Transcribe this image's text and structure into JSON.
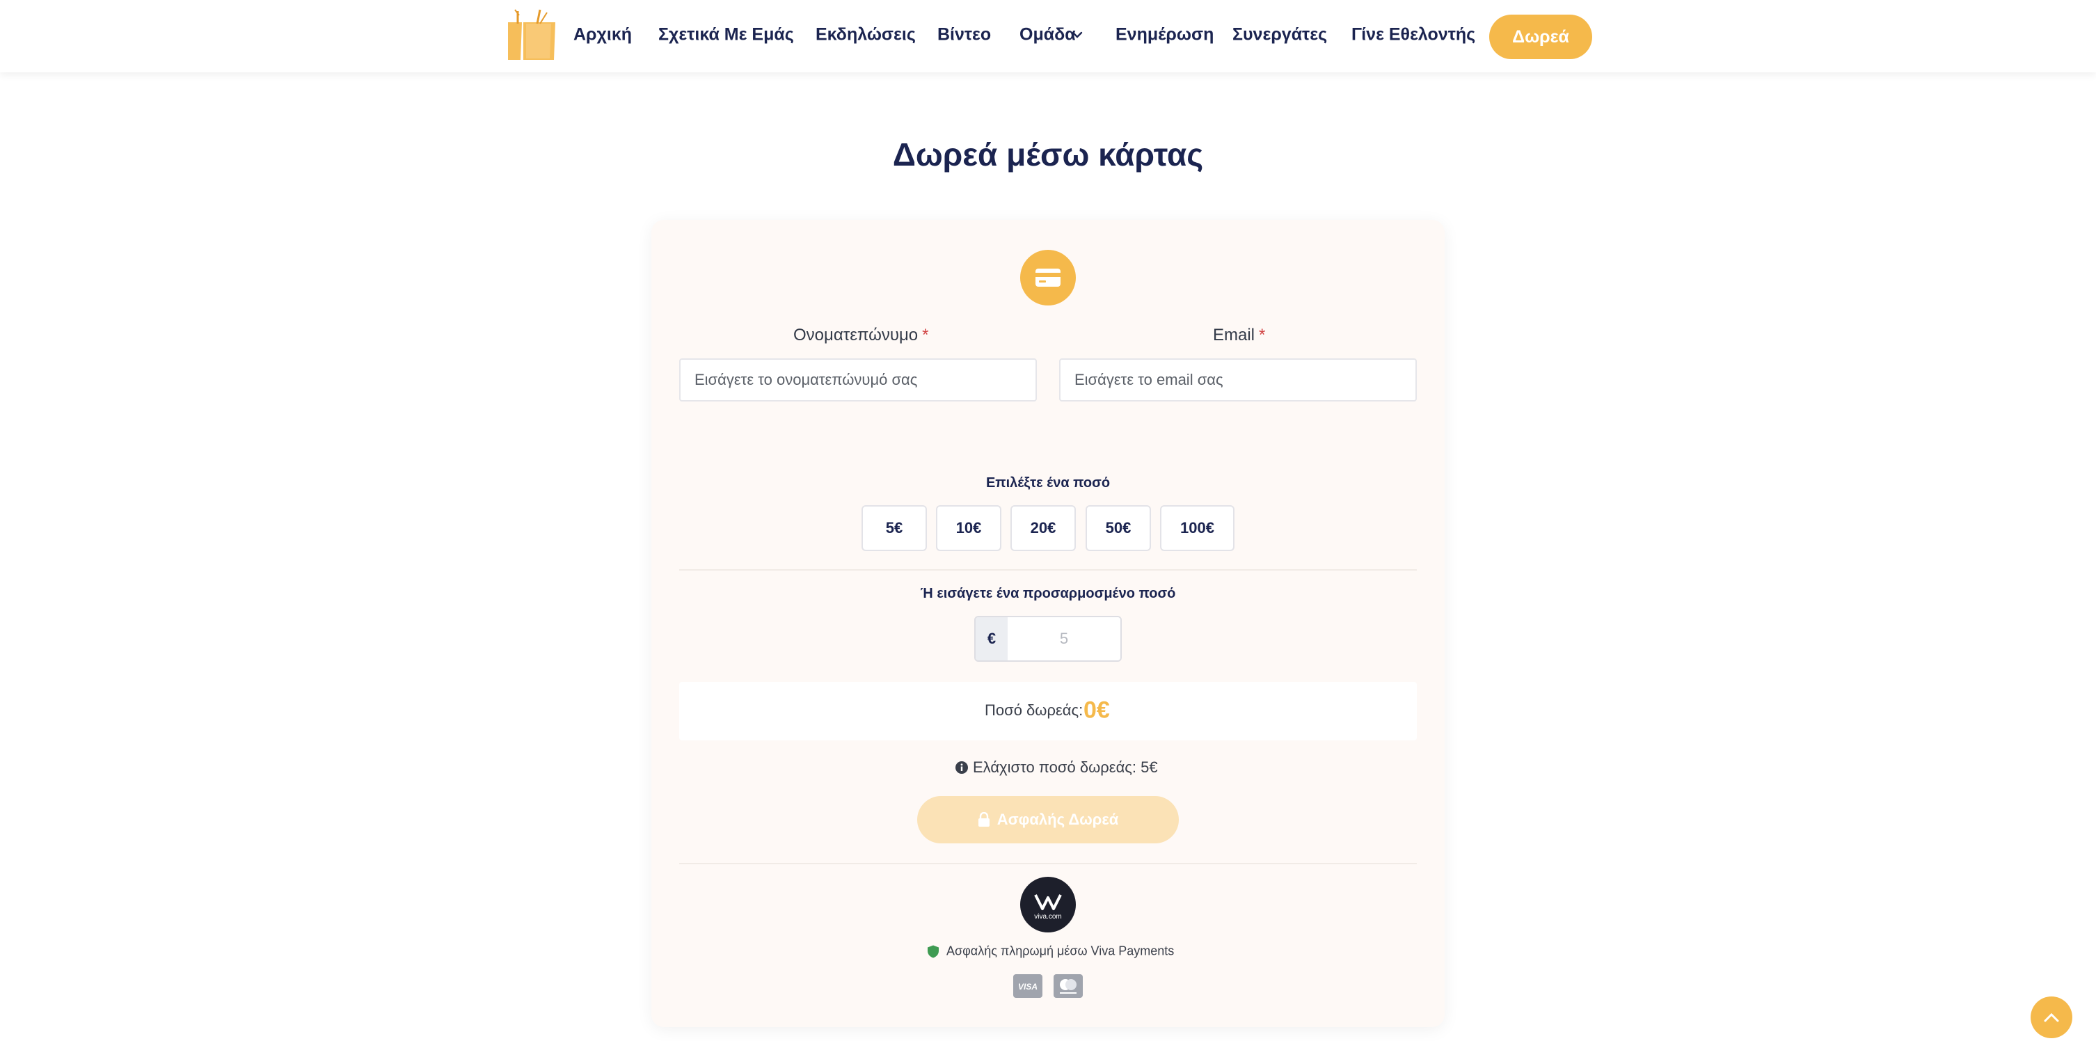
{
  "header": {
    "logo_icon": "team-logo-icon",
    "nav": [
      {
        "label": "Αρχική"
      },
      {
        "label": "Σχετικά Με Εμάς"
      },
      {
        "label": "Εκδηλώσεις"
      },
      {
        "label": "Βίντεο"
      },
      {
        "label": "Ομάδα",
        "has_dropdown": true
      },
      {
        "label": "Ενημέρωση"
      },
      {
        "label": "Συνεργάτες"
      },
      {
        "label": "Γίνε Εθελοντής"
      }
    ],
    "donate_button": "Δωρεά"
  },
  "page": {
    "title": "Δωρεά μέσω κάρτας"
  },
  "form": {
    "header_icon": "credit-card-icon",
    "name": {
      "label": "Ονοματεπώνυμο",
      "required_mark": "*",
      "placeholder": "Εισάγετε το ονοματεπώνυμό σας",
      "value": ""
    },
    "email": {
      "label": "Email",
      "required_mark": "*",
      "placeholder": "Εισάγετε το email σας",
      "value": ""
    },
    "preset_label": "Επιλέξτε ένα ποσό",
    "presets": [
      "5€",
      "10€",
      "20€",
      "50€",
      "100€"
    ],
    "custom_label": "Ή εισάγετε ένα προσαρμοσμένο ποσό",
    "custom_currency": "€",
    "custom_placeholder": "5",
    "total_label": "Ποσό δωρεάς:",
    "total_value": "0€",
    "min_note": "Ελάχιστο ποσό δωρεάς: 5€",
    "submit_label": "Ασφαλής Δωρεά",
    "submit_enabled": false,
    "secure_note": "Ασφαλής πληρωμή μέσω Viva Payments",
    "provider_logo_text": "viva.com",
    "card_brands": [
      "visa-icon",
      "mastercard-icon"
    ]
  },
  "colors": {
    "accent": "#f5b94b",
    "accent_disabled": "#fbe2b6",
    "navy": "#1b2450",
    "card_bg": "#fef9f6",
    "required": "#d14343",
    "shield_green": "#3f9b52"
  }
}
